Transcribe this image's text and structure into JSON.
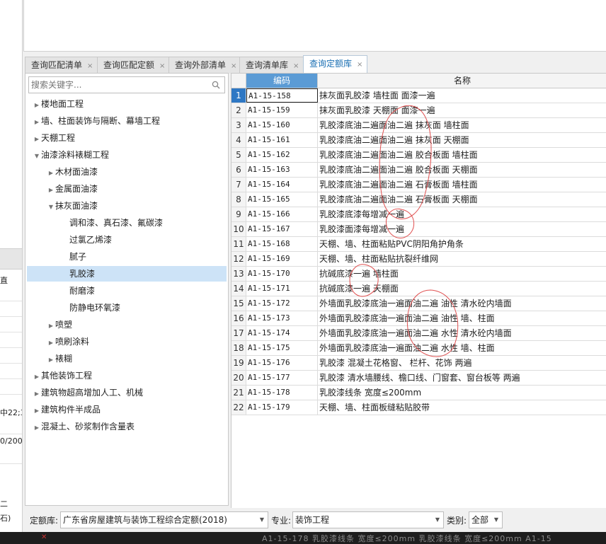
{
  "tabs": [
    {
      "label": "查询匹配清单",
      "close": "×"
    },
    {
      "label": "查询匹配定额",
      "close": "×"
    },
    {
      "label": "查询外部清单",
      "close": "×"
    },
    {
      "label": "查询清单库",
      "close": "×"
    },
    {
      "label": "查询定额库",
      "close": "×",
      "active": true
    }
  ],
  "search": {
    "placeholder": "搜索关键字..."
  },
  "tree": [
    {
      "label": "楼地面工程",
      "arrow": "▶"
    },
    {
      "label": "墙、柱面装饰与隔断、幕墙工程",
      "arrow": "▶"
    },
    {
      "label": "天棚工程",
      "arrow": "▶"
    },
    {
      "label": "油漆涂料裱糊工程",
      "arrow": "▼"
    },
    {
      "label": "木材面油漆",
      "arrow": "▶"
    },
    {
      "label": "金属面油漆",
      "arrow": "▶"
    },
    {
      "label": "抹灰面油漆",
      "arrow": "▼"
    },
    {
      "label": "调和漆、真石漆、氟碳漆",
      "arrow": ""
    },
    {
      "label": "过氯乙烯漆",
      "arrow": ""
    },
    {
      "label": "腻子",
      "arrow": ""
    },
    {
      "label": "乳胶漆",
      "arrow": "",
      "selected": true
    },
    {
      "label": "耐磨漆",
      "arrow": ""
    },
    {
      "label": "防静电环氧漆",
      "arrow": ""
    },
    {
      "label": "喷塑",
      "arrow": "▶"
    },
    {
      "label": "喷刷涂料",
      "arrow": "▶"
    },
    {
      "label": "裱糊",
      "arrow": "▶"
    },
    {
      "label": "其他装饰工程",
      "arrow": "▶"
    },
    {
      "label": "建筑物超高增加人工、机械",
      "arrow": "▶"
    },
    {
      "label": "建筑构件半成品",
      "arrow": "▶"
    },
    {
      "label": "混凝土、砂浆制作含量表",
      "arrow": "▶"
    }
  ],
  "grid": {
    "headers": {
      "code": "编码",
      "name": "名称"
    },
    "rows": [
      {
        "idx": "1",
        "code": "A1-15-158",
        "name": "抹灰面乳胶漆 墙柱面 面漆一遍"
      },
      {
        "idx": "2",
        "code": "A1-15-159",
        "name": "抹灰面乳胶漆 天棚面 面漆一遍"
      },
      {
        "idx": "3",
        "code": "A1-15-160",
        "name": "乳胶漆底油二遍面油二遍 抹灰面 墙柱面"
      },
      {
        "idx": "4",
        "code": "A1-15-161",
        "name": "乳胶漆底油二遍面油二遍 抹灰面 天棚面"
      },
      {
        "idx": "5",
        "code": "A1-15-162",
        "name": "乳胶漆底油二遍面油二遍 胶合板面 墙柱面"
      },
      {
        "idx": "6",
        "code": "A1-15-163",
        "name": "乳胶漆底油二遍面油二遍 胶合板面 天棚面"
      },
      {
        "idx": "7",
        "code": "A1-15-164",
        "name": "乳胶漆底油二遍面油二遍 石膏板面 墙柱面"
      },
      {
        "idx": "8",
        "code": "A1-15-165",
        "name": "乳胶漆底油二遍面油二遍 石膏板面 天棚面"
      },
      {
        "idx": "9",
        "code": "A1-15-166",
        "name": "乳胶漆底漆每增减一遍"
      },
      {
        "idx": "10",
        "code": "A1-15-167",
        "name": "乳胶漆面漆每增减一遍"
      },
      {
        "idx": "11",
        "code": "A1-15-168",
        "name": "天棚、墙、柱面粘贴PVC阴阳角护角条"
      },
      {
        "idx": "12",
        "code": "A1-15-169",
        "name": "天棚、墙、柱面粘贴抗裂纤维网"
      },
      {
        "idx": "13",
        "code": "A1-15-170",
        "name": "抗碱底漆一遍 墙柱面"
      },
      {
        "idx": "14",
        "code": "A1-15-171",
        "name": "抗碱底漆一遍 天棚面"
      },
      {
        "idx": "15",
        "code": "A1-15-172",
        "name": "外墙面乳胶漆底油一遍面油二遍 油性 清水砼内墙面"
      },
      {
        "idx": "16",
        "code": "A1-15-173",
        "name": "外墙面乳胶漆底油一遍面油二遍 油性 墙、柱面"
      },
      {
        "idx": "17",
        "code": "A1-15-174",
        "name": "外墙面乳胶漆底油一遍面油二遍 水性 清水砼内墙面"
      },
      {
        "idx": "18",
        "code": "A1-15-175",
        "name": "外墙面乳胶漆底油一遍面油二遍 水性 墙、柱面"
      },
      {
        "idx": "19",
        "code": "A1-15-176",
        "name": "乳胶漆 混凝土花格窗、 栏杆、花饰 两遍"
      },
      {
        "idx": "20",
        "code": "A1-15-177",
        "name": "乳胶漆 清水墙腰线、檐口线、门窗套、窗台板等 两遍"
      },
      {
        "idx": "21",
        "code": "A1-15-178",
        "name": "乳胶漆线条 宽度≤200mm"
      },
      {
        "idx": "22",
        "code": "A1-15-179",
        "name": "天棚、墙、柱面板缝粘贴胶带"
      }
    ]
  },
  "filters": {
    "quota_label": "定额库:",
    "quota_value": "广东省房屋建筑与装饰工程综合定额(2018)",
    "specialty_label": "专业:",
    "specialty_value": "装饰工程",
    "category_label": "类别:",
    "category_value": "全部"
  },
  "left_strip": {
    "header": "直",
    "text_a": "中22;3",
    "text_b": "0/200",
    "text_c": "二",
    "text_d": "石)"
  },
  "bottom_strip_text": "A1-15-178 乳胶漆线条 宽度≤200mm 乳胶漆线条 宽度≤200mm A1-15",
  "colors": {
    "accent": "#5b9bd5",
    "selected_tree": "#cde3f7",
    "annotation": "#e05050"
  }
}
